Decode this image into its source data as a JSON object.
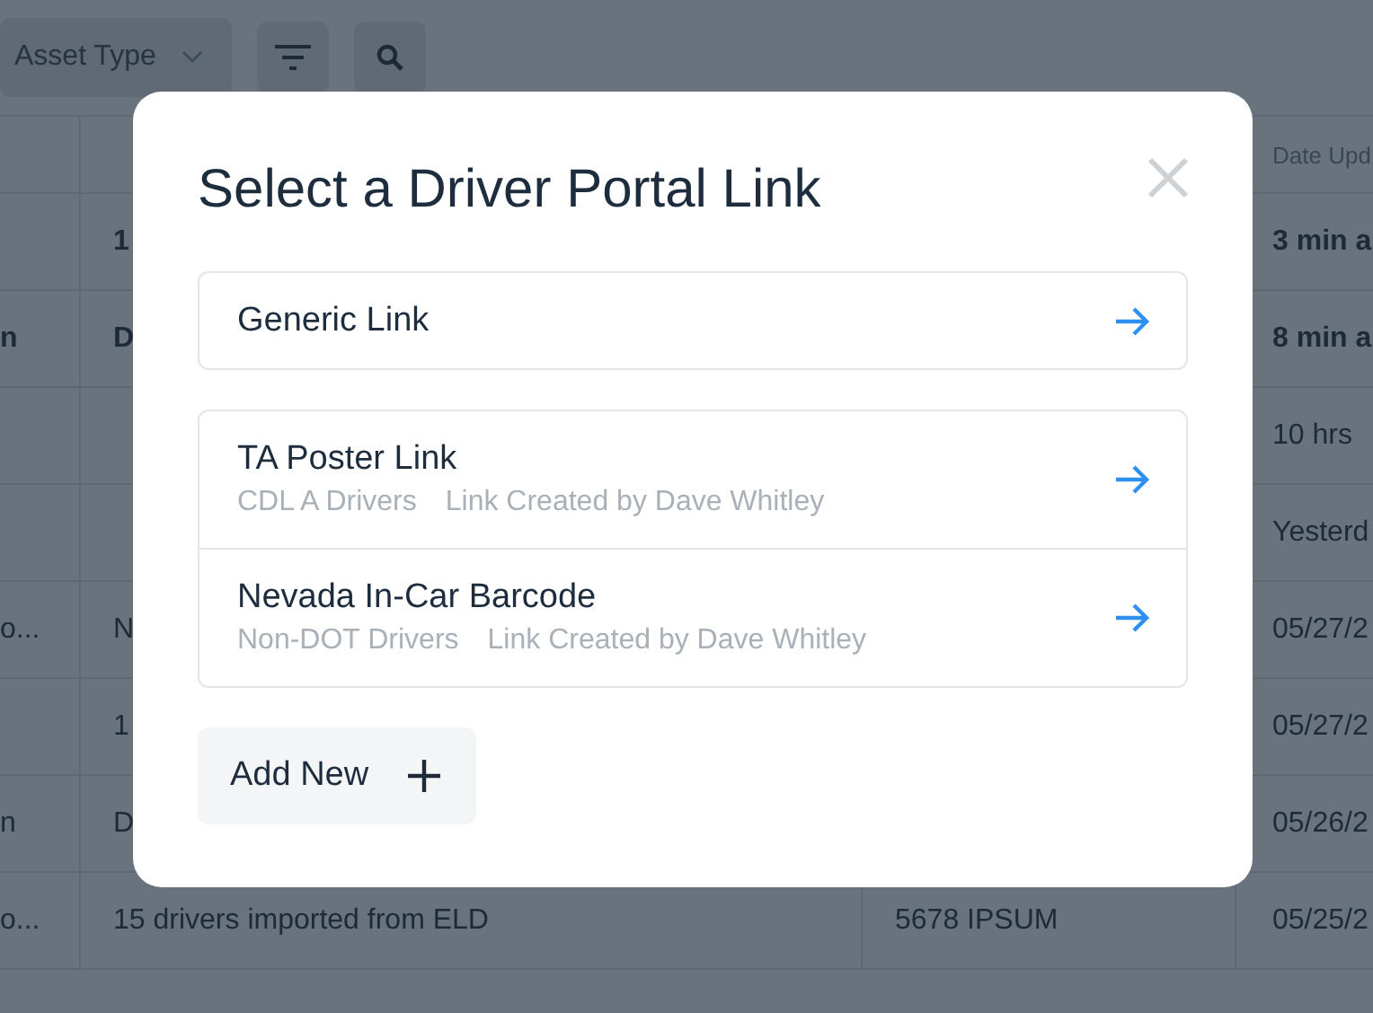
{
  "toolbar": {
    "asset_type_dropdown": "Asset Type"
  },
  "table": {
    "columns": [
      "",
      "",
      "",
      "Date Upd"
    ],
    "rows": [
      {
        "unread": true,
        "cells": [
          "",
          "1",
          "",
          "3 min a"
        ]
      },
      {
        "unread": true,
        "cells": [
          "n",
          "D",
          "",
          "8 min a"
        ]
      },
      {
        "unread": false,
        "cells": [
          "",
          "",
          "",
          "10 hrs"
        ]
      },
      {
        "unread": false,
        "cells": [
          "",
          "",
          "",
          "Yesterd"
        ]
      },
      {
        "unread": false,
        "cells": [
          "o...",
          "N",
          "",
          "05/27/2"
        ]
      },
      {
        "unread": false,
        "cells": [
          "",
          "1",
          "",
          "05/27/2"
        ]
      },
      {
        "unread": false,
        "cells": [
          "n",
          "D",
          "",
          "05/26/2"
        ]
      },
      {
        "unread": false,
        "cells": [
          "o...",
          "15 drivers imported from ELD",
          "5678 IPSUM",
          "05/25/2"
        ]
      }
    ]
  },
  "modal": {
    "title": "Select a Driver Portal Link",
    "generic_link": {
      "title": "Generic Link"
    },
    "links": [
      {
        "title": "TA Poster Link",
        "audience": "CDL A Drivers",
        "creator": "Link Created by Dave Whitley"
      },
      {
        "title": "Nevada In-Car Barcode",
        "audience": "Non-DOT Drivers",
        "creator": "Link Created by Dave Whitley"
      }
    ],
    "add_button": "Add New"
  }
}
